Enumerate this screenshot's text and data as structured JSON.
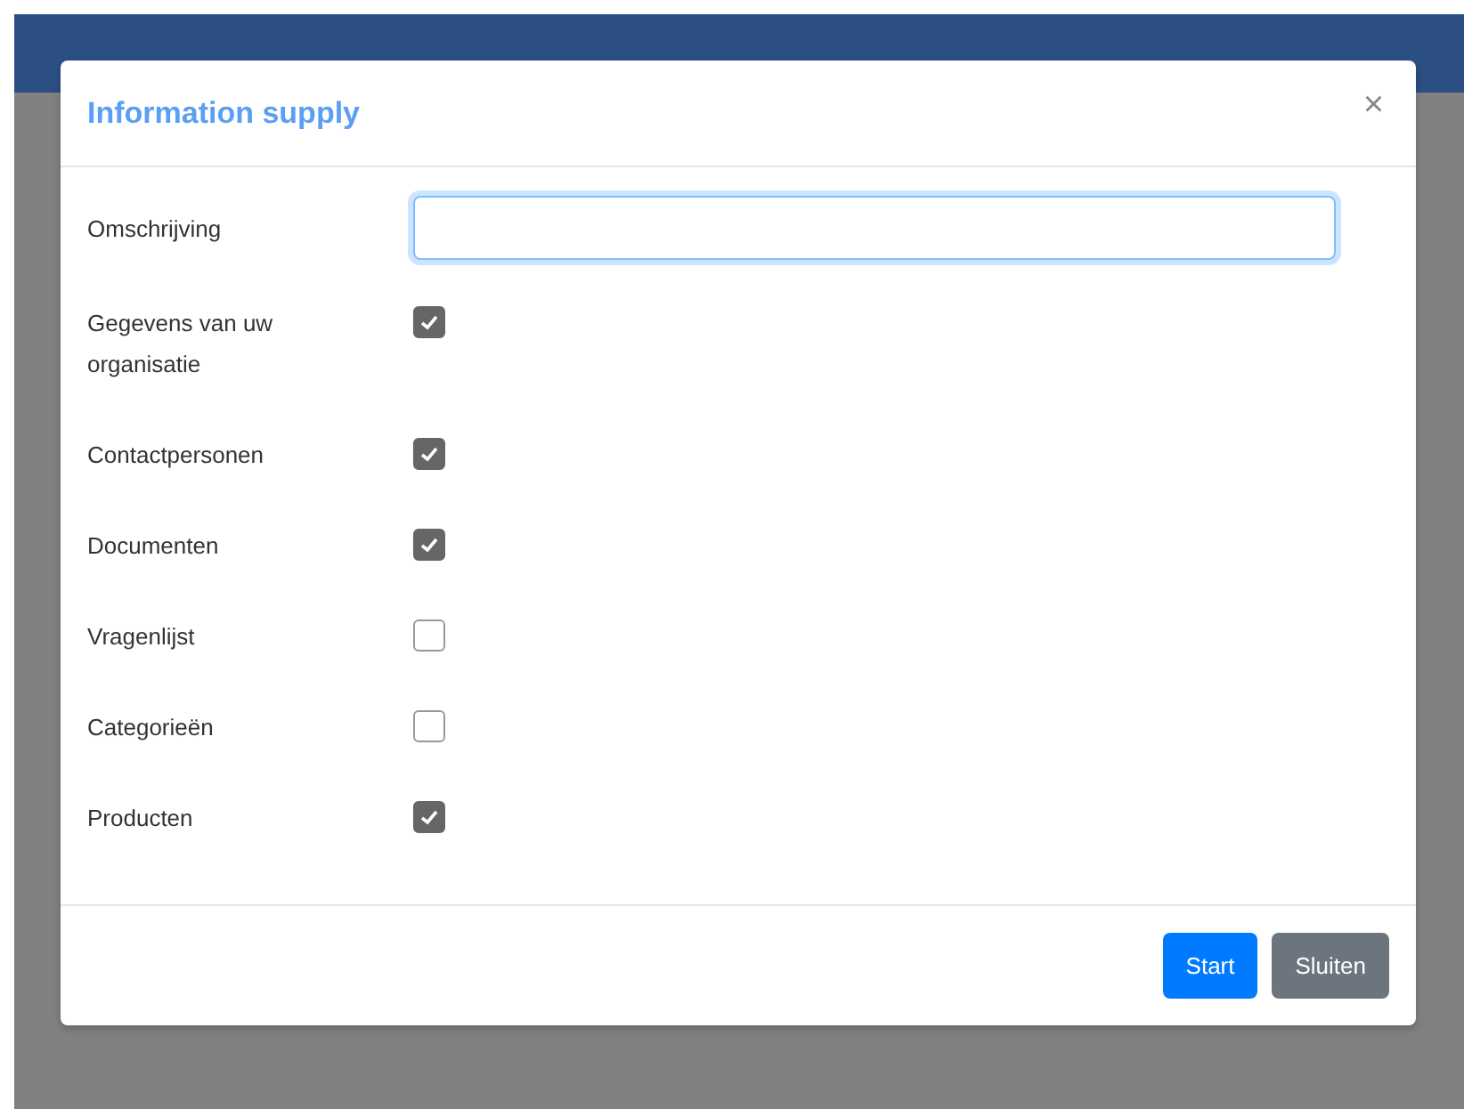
{
  "dialog": {
    "title": "Information supply",
    "close": "×"
  },
  "fields": [
    {
      "kind": "text",
      "label": "Omschrijving"
    },
    {
      "kind": "checkbox",
      "label": "Gegevens van uw organisatie",
      "checked": true
    },
    {
      "kind": "checkbox",
      "label": "Contactpersonen",
      "checked": true
    },
    {
      "kind": "checkbox",
      "label": "Documenten",
      "checked": true
    },
    {
      "kind": "checkbox",
      "label": "Vragenlijst",
      "checked": false
    },
    {
      "kind": "checkbox",
      "label": "Categorieën",
      "checked": false
    },
    {
      "kind": "checkbox",
      "label": "Producten",
      "checked": true
    }
  ],
  "buttons": [
    {
      "kind": "primary",
      "label": "Start"
    },
    {
      "kind": "secondary",
      "label": "Sluiten"
    }
  ]
}
